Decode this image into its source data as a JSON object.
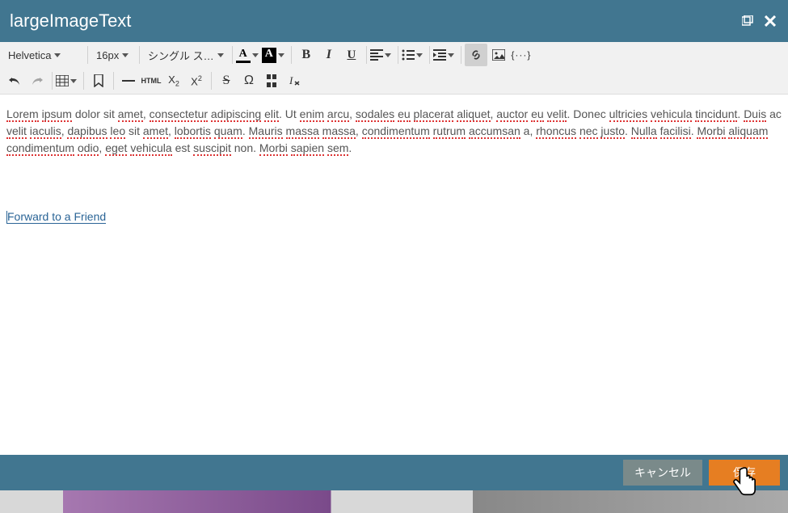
{
  "dialog": {
    "title": "largeImageText"
  },
  "toolbar": {
    "font_family": "Helvetica",
    "font_size": "16px",
    "line_height": "シングル ス…",
    "html_label": "HTML"
  },
  "editor": {
    "para1_words": [
      {
        "t": "Lorem",
        "s": 1
      },
      {
        "t": " "
      },
      {
        "t": "ipsum",
        "s": 1
      },
      {
        "t": " dolor sit "
      },
      {
        "t": "amet",
        "s": 1
      },
      {
        "t": ", "
      },
      {
        "t": "consectetur",
        "s": 1
      },
      {
        "t": " "
      },
      {
        "t": "adipiscing",
        "s": 1
      },
      {
        "t": " "
      },
      {
        "t": "elit",
        "s": 1
      },
      {
        "t": ". Ut "
      },
      {
        "t": "enim",
        "s": 1
      },
      {
        "t": " "
      },
      {
        "t": "arcu",
        "s": 1
      },
      {
        "t": ", "
      },
      {
        "t": "sodales",
        "s": 1
      },
      {
        "t": " "
      },
      {
        "t": "eu",
        "s": 1
      },
      {
        "t": " "
      },
      {
        "t": "placerat",
        "s": 1
      },
      {
        "t": " "
      },
      {
        "t": "aliquet",
        "s": 1
      },
      {
        "t": ", "
      },
      {
        "t": "auctor",
        "s": 1
      },
      {
        "t": " "
      },
      {
        "t": "eu",
        "s": 1
      },
      {
        "t": " "
      },
      {
        "t": "velit",
        "s": 1
      },
      {
        "t": ". Donec "
      },
      {
        "t": "ultricies",
        "s": 1
      },
      {
        "t": " "
      },
      {
        "t": "vehicula",
        "s": 1
      },
      {
        "t": " "
      },
      {
        "t": "tincidunt",
        "s": 1
      },
      {
        "t": ". "
      },
      {
        "t": "Duis",
        "s": 1
      },
      {
        "t": " ac "
      },
      {
        "t": "velit",
        "s": 1
      },
      {
        "t": " "
      },
      {
        "t": "iaculis",
        "s": 1
      },
      {
        "t": ", "
      },
      {
        "t": "dapibus",
        "s": 1
      },
      {
        "t": " "
      },
      {
        "t": "leo",
        "s": 1
      },
      {
        "t": " sit "
      },
      {
        "t": "amet",
        "s": 1
      },
      {
        "t": ", "
      },
      {
        "t": "lobortis",
        "s": 1
      },
      {
        "t": " "
      },
      {
        "t": "quam",
        "s": 1
      },
      {
        "t": ". "
      },
      {
        "t": "Mauris",
        "s": 1
      },
      {
        "t": " "
      },
      {
        "t": "massa",
        "s": 1
      },
      {
        "t": " "
      },
      {
        "t": "massa",
        "s": 1
      },
      {
        "t": ", "
      },
      {
        "t": "condimentum",
        "s": 1
      },
      {
        "t": " "
      },
      {
        "t": "rutrum",
        "s": 1
      },
      {
        "t": " "
      },
      {
        "t": "accumsan",
        "s": 1
      },
      {
        "t": " a, "
      },
      {
        "t": "rhoncus",
        "s": 1
      },
      {
        "t": " "
      },
      {
        "t": "nec",
        "s": 1
      },
      {
        "t": " "
      },
      {
        "t": "justo",
        "s": 1
      },
      {
        "t": ". "
      },
      {
        "t": "Nulla",
        "s": 1
      },
      {
        "t": " "
      },
      {
        "t": "facilisi",
        "s": 1
      },
      {
        "t": ". "
      },
      {
        "t": "Morbi",
        "s": 1
      },
      {
        "t": " "
      },
      {
        "t": "aliquam",
        "s": 1
      },
      {
        "t": " "
      },
      {
        "t": "condimentum",
        "s": 1
      },
      {
        "t": " "
      },
      {
        "t": "odio",
        "s": 1
      },
      {
        "t": ", "
      },
      {
        "t": "eget",
        "s": 1
      },
      {
        "t": " "
      },
      {
        "t": "vehicula",
        "s": 1
      },
      {
        "t": " est "
      },
      {
        "t": "suscipit",
        "s": 1
      },
      {
        "t": " non. "
      },
      {
        "t": "Morbi",
        "s": 1
      },
      {
        "t": " "
      },
      {
        "t": "sapien",
        "s": 1
      },
      {
        "t": " "
      },
      {
        "t": "sem",
        "s": 1
      },
      {
        "t": "."
      }
    ],
    "link_text": "Forward to a Friend"
  },
  "footer": {
    "cancel": "キャンセル",
    "save": "保存"
  }
}
